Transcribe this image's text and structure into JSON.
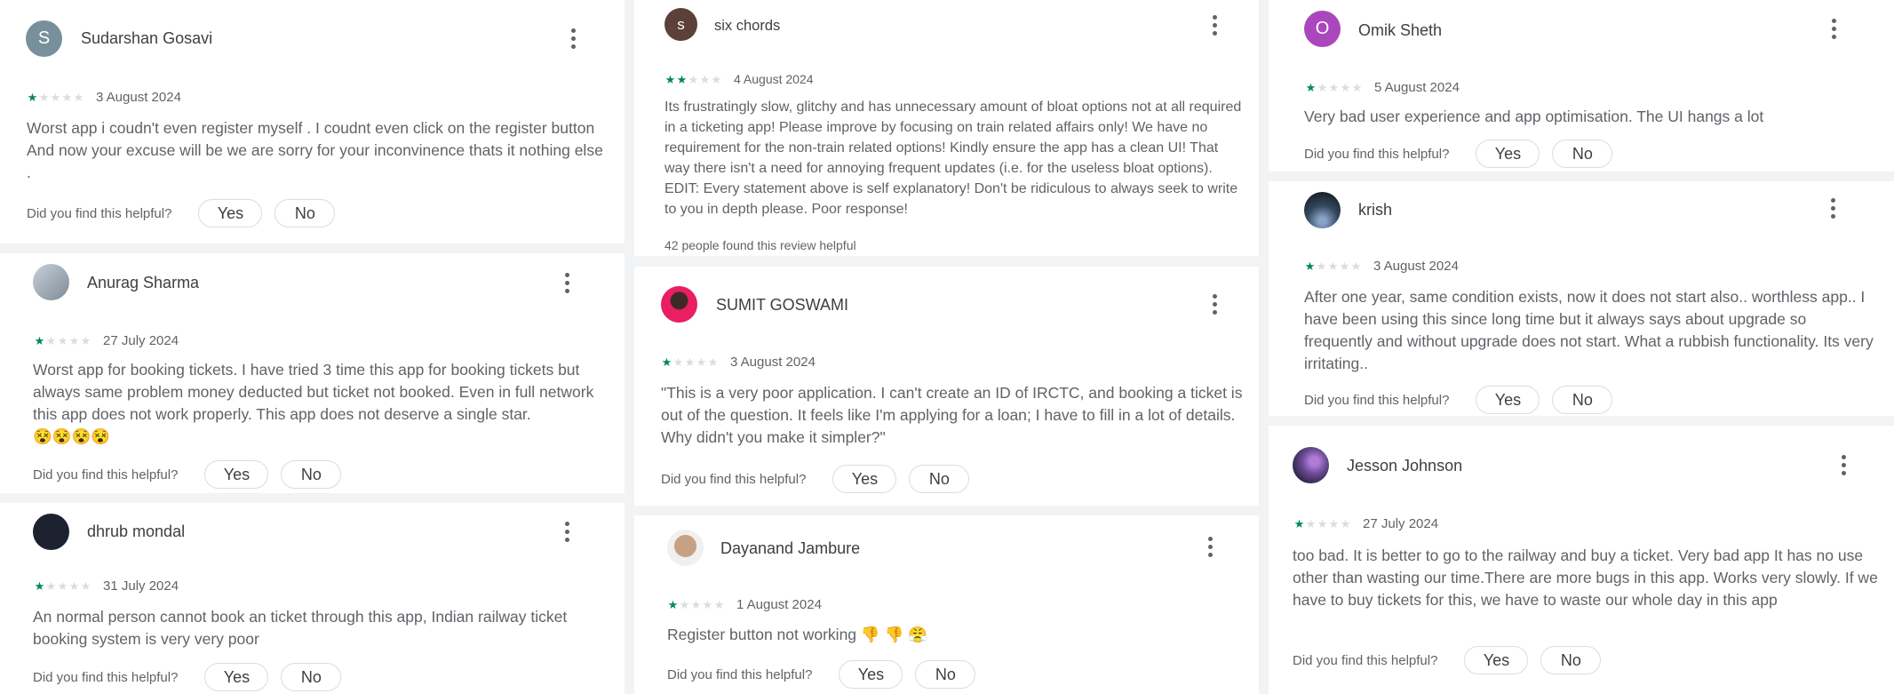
{
  "colors": {
    "star_filled": "#01875f",
    "star_empty": "#dadce0",
    "text_secondary": "#5f6368"
  },
  "helpful_question": "Did you find this helpful?",
  "yes_label": "Yes",
  "no_label": "No",
  "reviews": [
    {
      "name": "Sudarshan Gosavi",
      "avatar_letter": "S",
      "avatar_color": "#78909c",
      "rating": 1,
      "date": "3 August 2024",
      "text": "Worst app i coudn't even register myself . I coudnt even click on the register button And now your excuse will be we are sorry for your inconvinence thats it nothing else ."
    },
    {
      "name": "Anurag Sharma",
      "avatar_color": "#9aa7b4",
      "rating": 1,
      "date": "27 July 2024",
      "text": "Worst app for booking tickets. I have tried 3 time this app for booking tickets but always same problem money deducted but ticket not booked. Even in full network this app does not work properly. This app does not deserve a single star.",
      "emoji": "😵😵😵😵"
    },
    {
      "name": "dhrub mondal",
      "avatar_color": "#1c2230",
      "rating": 1,
      "date": "31 July 2024",
      "text": "An normal person cannot book an ticket through this app, Indian railway ticket booking system is very very poor"
    },
    {
      "name": "six chords",
      "avatar_letter": "s",
      "avatar_color": "#5d4037",
      "rating": 2,
      "date": "4 August 2024",
      "text": "Its frustratingly slow, glitchy and has unnecessary amount of bloat options not at all required in a ticketing app! Please improve by focusing on train related affairs only! We have no requirement for the non-train related options! Kindly ensure the app has a clean UI! That way there isn't a need for annoying frequent updates (i.e. for the useless bloat options). EDIT: Every statement above is self explanatory! Don't be ridiculous to always seek to write to you in depth please. Poor response!",
      "helpful_count": "42 people found this review helpful"
    },
    {
      "name": "SUMIT GOSWAMI",
      "avatar_color": "#e91e63",
      "rating": 1,
      "date": "3 August 2024",
      "text": "\"This is a very poor application. I can't create an ID of IRCTC, and booking a ticket is out of the question. It feels like I'm applying for a loan; I have to fill in a lot of details. Why didn't you make it simpler?\""
    },
    {
      "name": "Dayanand Jambure",
      "avatar_color": "#c7a184",
      "rating": 1,
      "date": "1 August 2024",
      "text": "Register button not working",
      "emoji": "👎 👎  😤"
    },
    {
      "name": "Omik Sheth",
      "avatar_letter": "O",
      "avatar_color": "#ab47bc",
      "rating": 1,
      "date": "5 August 2024",
      "text": "Very bad user experience and app optimisation. The UI hangs a lot"
    },
    {
      "name": "krish",
      "avatar_color": "#34495e",
      "rating": 1,
      "date": "3 August 2024",
      "text": "After one year, same condition exists, now it does not start also.. worthless app.. I have been using this since long time but it always says about upgrade so frequently and without upgrade does not start. What a rubbish functionality. Its very irritating.."
    },
    {
      "name": "Jesson Johnson",
      "avatar_color": "#6a4c93",
      "rating": 1,
      "date": "27 July 2024",
      "text": "too bad. It is better to go to the railway and buy a ticket. Very bad app It has no use other than wasting our time.There are more bugs in this app. Works very slowly. If we have to buy tickets for this, we have to waste our whole day in this app"
    }
  ]
}
